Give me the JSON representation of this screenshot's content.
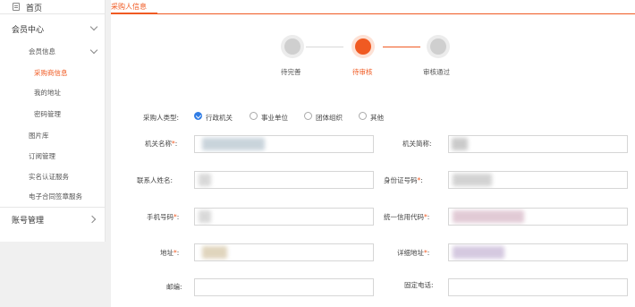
{
  "sidebar": {
    "home": "首页",
    "member_center": "会员中心",
    "member_info": "会员信息",
    "items": [
      {
        "label": "采购商信息",
        "active": true
      },
      {
        "label": "我的地址",
        "active": false
      },
      {
        "label": "密码管理",
        "active": false
      }
    ],
    "top_items": [
      {
        "label": "图片库"
      },
      {
        "label": "订阅管理"
      },
      {
        "label": "实名认证服务"
      },
      {
        "label": "电子合同签章服务"
      }
    ],
    "account_mgmt": "账号管理"
  },
  "tabs": [
    {
      "label": "采购人信息",
      "active": true
    }
  ],
  "steps": [
    {
      "label": "待完善",
      "state": "done",
      "color": "#cfcfcf"
    },
    {
      "label": "待审核",
      "state": "current",
      "color": "#f05a22"
    },
    {
      "label": "审核通过",
      "state": "pending",
      "color": "#cfcfcf"
    }
  ],
  "form": {
    "buyer_type": {
      "label": "采购人类型:",
      "options": [
        {
          "label": "行政机关",
          "checked": true
        },
        {
          "label": "事业单位",
          "checked": false
        },
        {
          "label": "团体组织",
          "checked": false
        },
        {
          "label": "其他",
          "checked": false
        }
      ]
    },
    "org_name": {
      "label": "机关名称",
      "required": true,
      "value": ""
    },
    "org_short_name": {
      "label": "机关简称:",
      "required": false,
      "value": ""
    },
    "contact_name": {
      "label": "联系人姓名:",
      "required": false,
      "value": ""
    },
    "id_number": {
      "label": "身份证号码",
      "required": true,
      "value": ""
    },
    "phone": {
      "label": "手机号码",
      "required": true,
      "value": ""
    },
    "credit_code": {
      "label": "统一信用代码",
      "required": true,
      "value": ""
    },
    "address": {
      "label": "地址",
      "required": true,
      "value": ""
    },
    "detail_address": {
      "label": "详细地址",
      "required": true,
      "value": ""
    },
    "postcode": {
      "label": "邮编:",
      "required": false,
      "value": ""
    },
    "landline": {
      "label": "固定电话:",
      "required": false,
      "value": ""
    }
  },
  "colors": {
    "accent": "#f05a22",
    "radio_checked": "#2f7ce5",
    "step_inactive": "#cfcfcf"
  }
}
